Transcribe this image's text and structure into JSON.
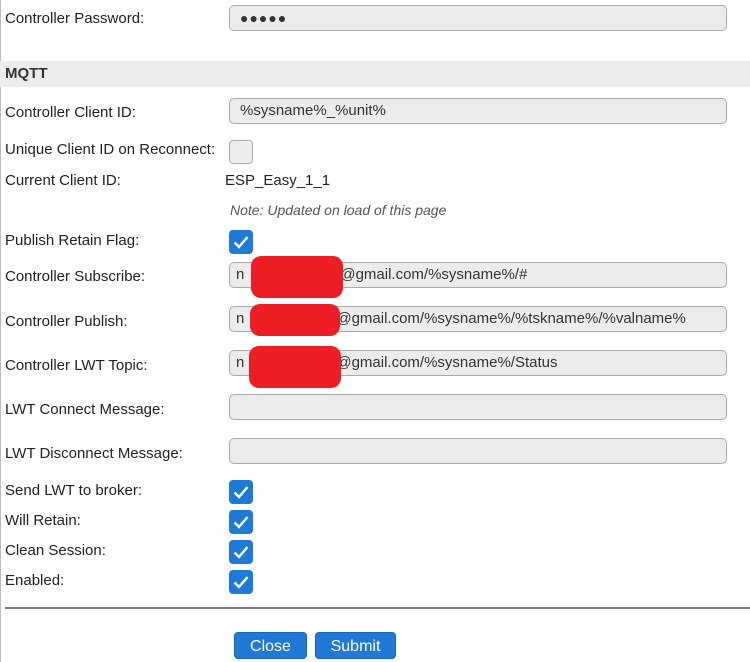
{
  "fields": {
    "controller_password": {
      "label": "Controller Password:",
      "value": "●●●●●"
    },
    "client_id": {
      "label": "Controller Client ID:",
      "value": "%sysname%_%unit%"
    },
    "unique_client_id": {
      "label": "Unique Client ID on Reconnect:",
      "checked": false
    },
    "current_client_id": {
      "label": "Current Client ID:",
      "value": "ESP_Easy_1_1",
      "note": "Note: Updated on load of this page"
    },
    "retain_flag": {
      "label": "Publish Retain Flag:",
      "checked": true
    },
    "subscribe": {
      "label": "Controller Subscribe:",
      "prefix": "n",
      "value": "@gmail.com/%sysname%/#"
    },
    "publish": {
      "label": "Controller Publish:",
      "prefix": "n",
      "value": "@gmail.com/%sysname%/%tskname%/%valname%"
    },
    "lwt_topic": {
      "label": "Controller LWT Topic:",
      "prefix": "n",
      "value": "@gmail.com/%sysname%/Status"
    },
    "lwt_connect": {
      "label": "LWT Connect Message:",
      "value": ""
    },
    "lwt_disconnect": {
      "label": "LWT Disconnect Message:",
      "value": ""
    },
    "send_lwt": {
      "label": "Send LWT to broker:",
      "checked": true
    },
    "will_retain": {
      "label": "Will Retain:",
      "checked": true
    },
    "clean_session": {
      "label": "Clean Session:",
      "checked": true
    },
    "enabled": {
      "label": "Enabled:",
      "checked": true
    }
  },
  "section_mqtt": "MQTT",
  "buttons": {
    "close": "Close",
    "submit": "Submit"
  },
  "colors": {
    "accent": "#1e7ad6",
    "input_bg": "#ececec",
    "redaction": "#ee1c25"
  }
}
